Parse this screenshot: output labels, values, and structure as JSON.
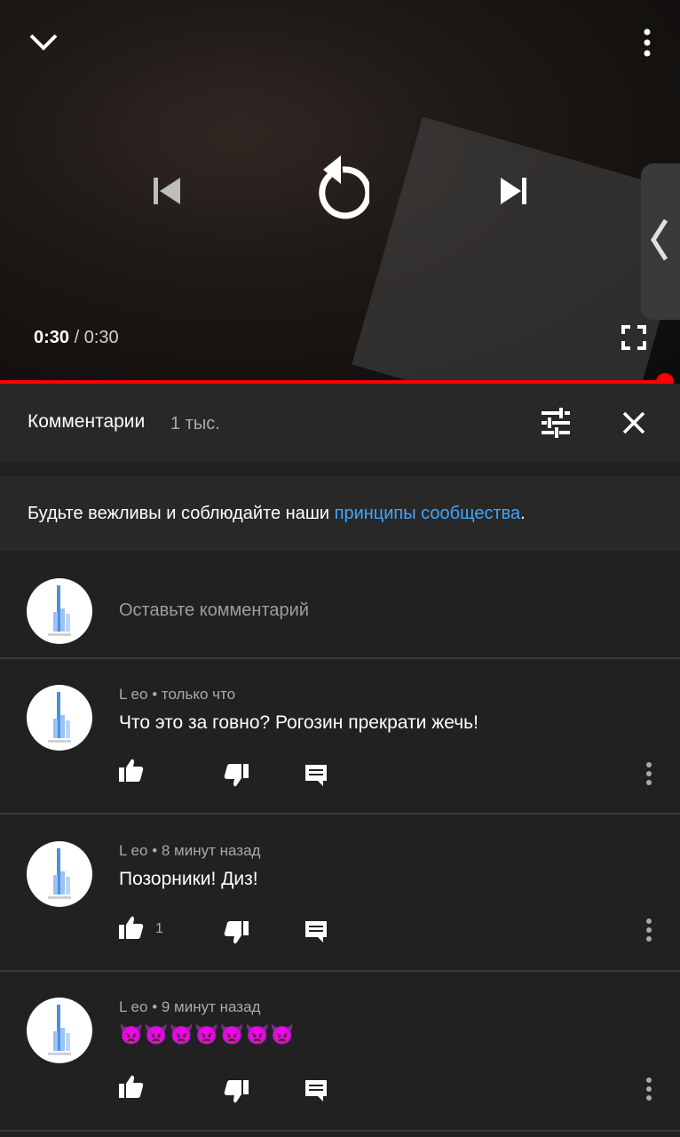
{
  "player": {
    "time_current": "0:30",
    "time_separator": " / ",
    "time_duration": "0:30",
    "progress_fraction": 1.0,
    "icons": [
      "chevron-down-icon",
      "more-vert-icon",
      "skip-previous-icon",
      "replay-icon",
      "skip-next-icon",
      "fullscreen-icon",
      "chevron-left-icon"
    ]
  },
  "comments_header": {
    "title": "Комментарии",
    "count": "1 тыс.",
    "icons": [
      "sort-filter-icon",
      "close-icon"
    ]
  },
  "guidelines": {
    "text_before": "Будьте вежливы и соблюдайте наши ",
    "link_text": "принципы сообщества",
    "text_after": "."
  },
  "add_comment": {
    "placeholder": "Оставьте комментарий"
  },
  "comments": [
    {
      "author": "L eo",
      "separator": " • ",
      "time": "только что",
      "text": "Что это за говно? Рогозин прекрати жечь!",
      "likes": ""
    },
    {
      "author": "L eo",
      "separator": " • ",
      "time": "8 минут назад",
      "text": "Позорники! Диз!",
      "likes": "1"
    },
    {
      "author": "L eo",
      "separator": " • ",
      "time": "9 минут назад",
      "text": "👿👿👿👿👿👿👿",
      "likes": ""
    }
  ],
  "colors": {
    "background": "#212121",
    "panel": "#282828",
    "accent_red": "#ff0000",
    "link_blue": "#3ea6ff",
    "secondary_text": "#aaaaaa"
  }
}
